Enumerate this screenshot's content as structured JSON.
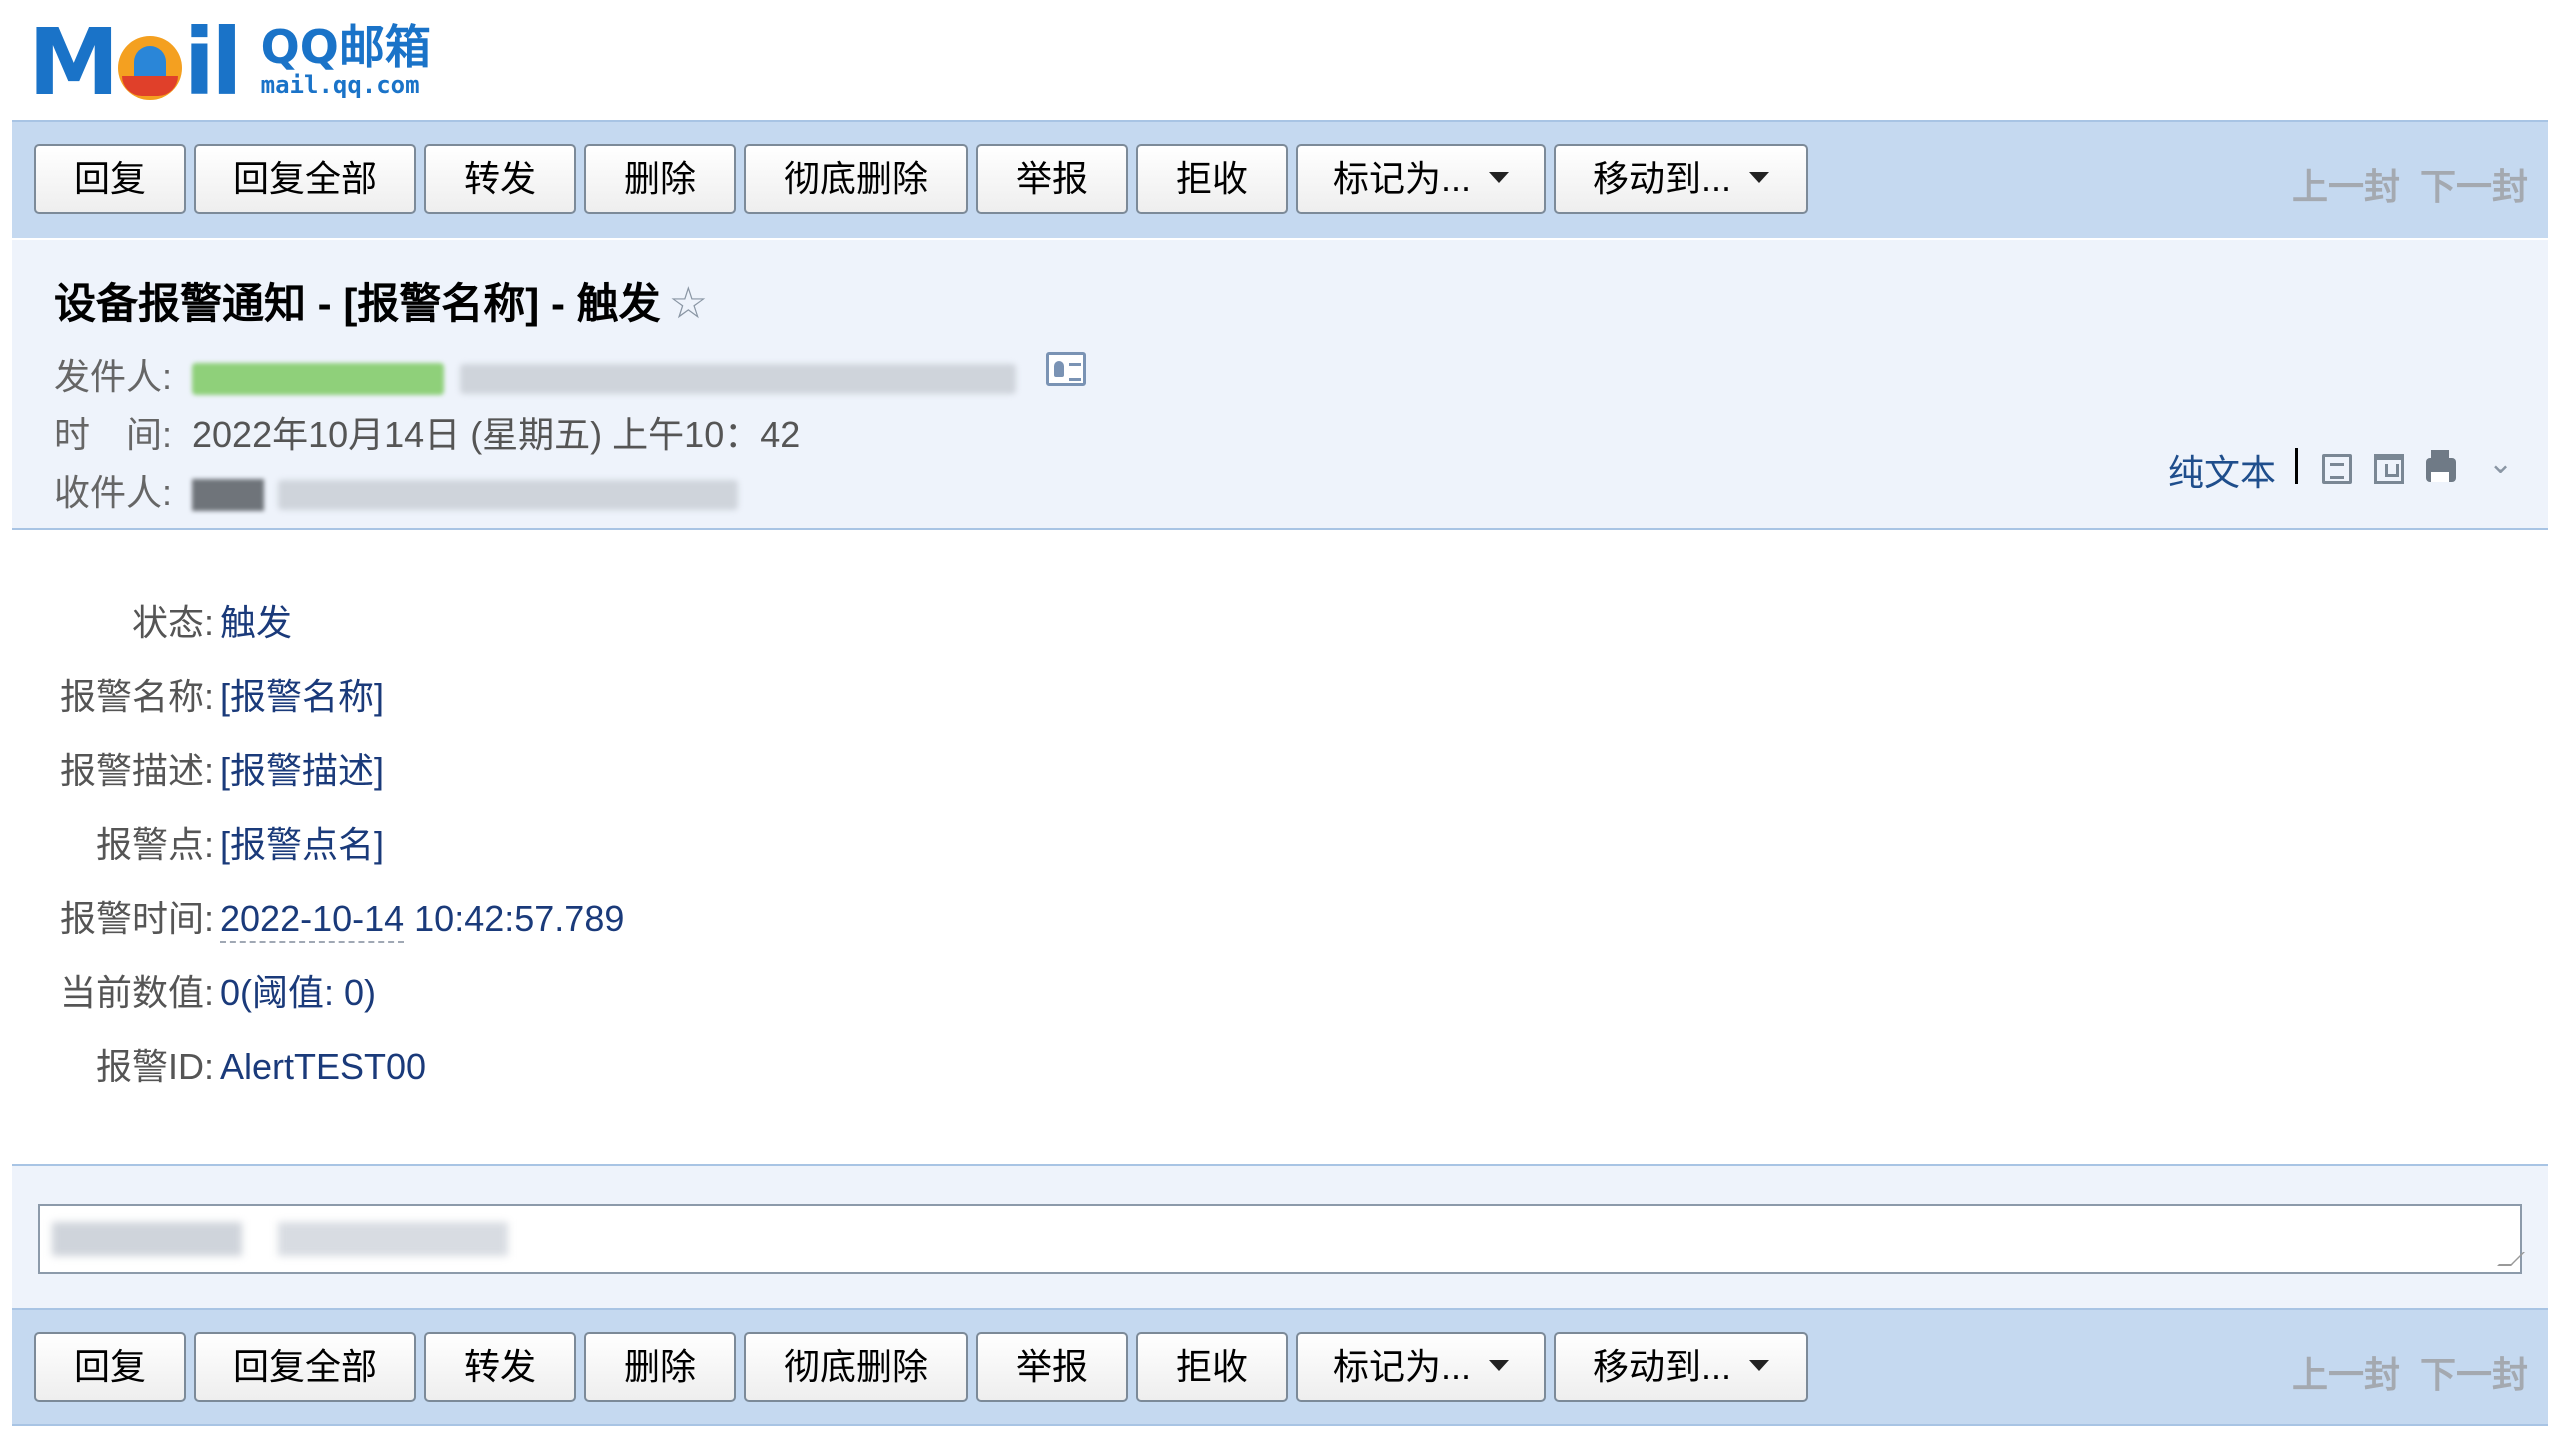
{
  "logo": {
    "wordmark": "M",
    "wordmark_end": "il",
    "product": "QQ邮箱",
    "domain": "mail.qq.com"
  },
  "toolbar": {
    "reply": "回复",
    "reply_all": "回复全部",
    "forward": "转发",
    "delete": "删除",
    "delete_forever": "彻底删除",
    "report": "举报",
    "reject": "拒收",
    "mark_as": "标记为...",
    "move_to": "移动到...",
    "prev": "上一封",
    "next": "下一封"
  },
  "message": {
    "subject": "设备报警通知 - [报警名称] - 触发",
    "star": "☆",
    "from_label": "发件人:",
    "time_label": "时　间:",
    "time_value": "2022年10月14日 (星期五) 上午10：42",
    "to_label": "收件人:",
    "plain_text": "纯文本",
    "chevron": "⌄"
  },
  "fields": [
    {
      "key": "状态:",
      "value": "触发"
    },
    {
      "key": "报警名称:",
      "value": "[报警名称]"
    },
    {
      "key": "报警描述:",
      "value": "[报警描述]"
    },
    {
      "key": "报警点:",
      "value": "[报警点名]"
    },
    {
      "key": "报警时间:",
      "value_date": "2022-10-14",
      "value_time": " 10:42:57.789"
    },
    {
      "key": "当前数值:",
      "value": "0(阈值: 0)"
    },
    {
      "key": "报警ID:",
      "value": "AlertTEST00"
    }
  ]
}
